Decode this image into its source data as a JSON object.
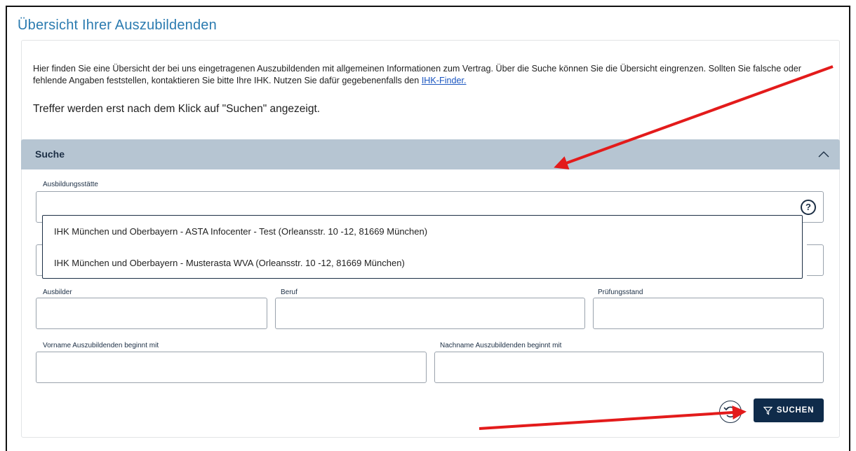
{
  "page": {
    "title": "Übersicht Ihrer Auszubildenden",
    "intro_text": "Hier finden Sie eine Übersicht der bei uns eingetragenen Auszubildenden mit allgemeinen Informationen zum Vertrag. Über die Suche können Sie die Übersicht eingrenzen. Sollten Sie falsche oder fehlende Angaben feststellen, kontaktieren Sie bitte Ihre IHK. Nutzen Sie dafür gegebenenfalls den ",
    "intro_link": "IHK-Finder.",
    "hint": "Treffer werden erst nach dem Klick auf \"Suchen\" angezeigt."
  },
  "search": {
    "section_label": "Suche",
    "fields": {
      "ausbildungsstaette_label": "Ausbildungsstätte",
      "ausbilder_label": "Ausbilder",
      "beruf_label": "Beruf",
      "pruefungsstand_label": "Prüfungsstand",
      "vorname_label": "Vorname Auszubildenden beginnt mit",
      "nachname_label": "Nachname Auszubildenden beginnt mit"
    },
    "dropdown_options": [
      "IHK München und Oberbayern - ASTA Infocenter - Test (Orleansstr. 10 -12, 81669 München)",
      "IHK München und Oberbayern - Musterasta WVA (Orleansstr. 10 -12, 81669 München)"
    ],
    "help_symbol": "?",
    "submit_label": "SUCHEN"
  },
  "icons": {
    "collapse": "chevron-up-icon",
    "help": "question-circle-icon",
    "reset": "reset-icon",
    "filter": "filter-icon"
  },
  "colors": {
    "title": "#2b7bb0",
    "section_bar": "#b6c5d2",
    "primary_button": "#0f2b4a",
    "annotation_arrow": "#e31b1b"
  }
}
